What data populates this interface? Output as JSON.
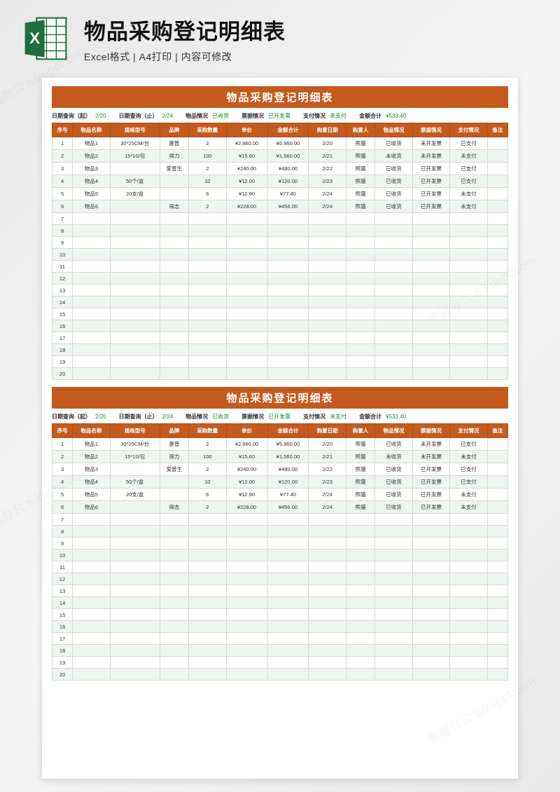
{
  "header": {
    "main_title": "物品采购登记明细表",
    "sub_title": "Excel格式 | A4打印 | 内容可修改"
  },
  "sheet": {
    "title": "物品采购登记明细表",
    "filters": {
      "date_from_label": "日期查询（起）",
      "date_from_value": "2/20",
      "date_to_label": "日期查询（止）",
      "date_to_value": "2/24",
      "item_status_label": "物品情况",
      "item_status_value": "已收货",
      "invoice_status_label": "票据情况",
      "invoice_status_value": "已开发票",
      "pay_status_label": "支付情况",
      "pay_status_value": "未支付",
      "total_label": "金额合计",
      "total_value": "¥533.40"
    },
    "columns": [
      "序号",
      "物品名称",
      "规格型号",
      "品牌",
      "采购数量",
      "单价",
      "金额合计",
      "购置日期",
      "购置人",
      "物品情况",
      "票据情况",
      "支付情况",
      "备注"
    ],
    "rows": [
      {
        "no": "1",
        "name": "物品1",
        "spec": "30*25CM/台",
        "brand": "惠普",
        "qty": "2",
        "price": "¥2,980.00",
        "amount": "¥5,960.00",
        "date": "2/20",
        "buyer": "熊猫",
        "item": "已收货",
        "inv": "未开发票",
        "pay": "已支付",
        "note": ""
      },
      {
        "no": "2",
        "name": "物品2",
        "spec": "15*10/包",
        "brand": "得力",
        "qty": "100",
        "price": "¥15.60",
        "amount": "¥1,560.00",
        "date": "2/21",
        "buyer": "熊猫",
        "item": "未收货",
        "inv": "未开发票",
        "pay": "未支付",
        "note": ""
      },
      {
        "no": "3",
        "name": "物品3",
        "spec": "",
        "brand": "爱普生",
        "qty": "2",
        "price": "¥240.00",
        "amount": "¥480.00",
        "date": "2/22",
        "buyer": "熊猫",
        "item": "已收货",
        "inv": "已开发票",
        "pay": "已支付",
        "note": ""
      },
      {
        "no": "4",
        "name": "物品4",
        "spec": "50个/盒",
        "brand": "",
        "qty": "10",
        "price": "¥12.00",
        "amount": "¥120.00",
        "date": "2/23",
        "buyer": "熊猫",
        "item": "已收货",
        "inv": "已开发票",
        "pay": "已支付",
        "note": ""
      },
      {
        "no": "5",
        "name": "物品5",
        "spec": "20支/盒",
        "brand": "",
        "qty": "6",
        "price": "¥12.90",
        "amount": "¥77.40",
        "date": "2/24",
        "buyer": "熊猫",
        "item": "已收货",
        "inv": "已开发票",
        "pay": "未支付",
        "note": ""
      },
      {
        "no": "6",
        "name": "物品6",
        "spec": "",
        "brand": "得志",
        "qty": "2",
        "price": "¥228.00",
        "amount": "¥456.00",
        "date": "2/24",
        "buyer": "熊猫",
        "item": "已收货",
        "inv": "已开发票",
        "pay": "未支付",
        "note": ""
      }
    ],
    "empty_from": 7,
    "empty_to": 20
  },
  "watermark": "熊猫办公 tukuppt.com"
}
